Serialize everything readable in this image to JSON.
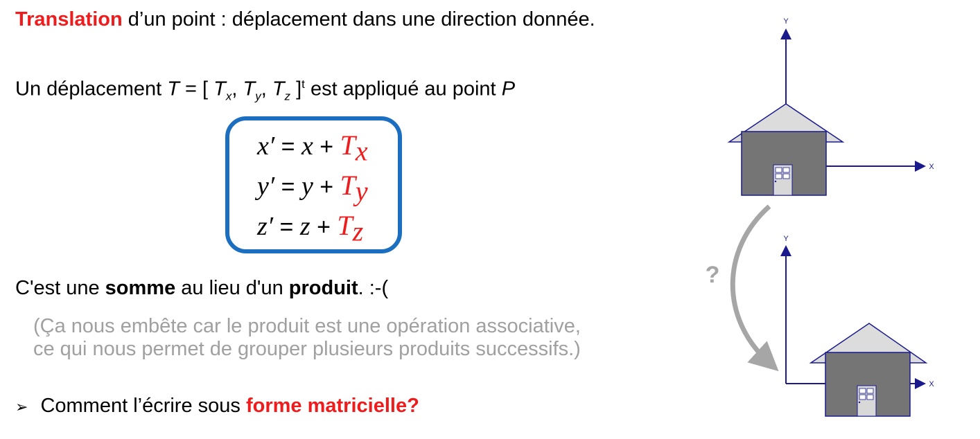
{
  "title": {
    "keyword": "Translation",
    "rest": " d’un point : déplacement dans une direction donnée."
  },
  "deplacement": {
    "prefix": "Un déplacement ",
    "T": "T",
    "eq_open": " = [ ",
    "Tx": "T",
    "x": "x",
    "sep1": ", ",
    "Ty": "T",
    "y": "y",
    "sep2": ", ",
    "Tz": "T",
    "z": "z",
    "close": " ]",
    "t": "t",
    "suffix": " est appliqué au point ",
    "P": "P"
  },
  "equations": [
    {
      "lhs": "x′",
      "eq": " = ",
      "var": "x",
      "plus": " + ",
      "T": "T",
      "sub": "x"
    },
    {
      "lhs": "y′",
      "eq": " = ",
      "var": "y",
      "plus": " + ",
      "T": "T",
      "sub": "y"
    },
    {
      "lhs": "z′",
      "eq": " = ",
      "var": "z",
      "plus": " + ",
      "T": "T",
      "sub": "z"
    }
  ],
  "somme": {
    "p1": "C'est une ",
    "b1": "somme",
    "p2": " au lieu d'un ",
    "b2": "produit",
    "p3": ".  :-("
  },
  "note": {
    "line1": "(Ça nous embête car le produit est une opération associative,",
    "line2": "ce qui nous permet de grouper plusieurs produits successifs.)"
  },
  "question": {
    "bullet": "➢",
    "text": "Comment l’écrire sous ",
    "highlight": "forme matricielle?"
  },
  "diagram": {
    "axis_y_top": "Y",
    "axis_x_top": "X",
    "axis_y_bottom": "Y",
    "axis_x_bottom": "X",
    "question_mark": "?"
  }
}
